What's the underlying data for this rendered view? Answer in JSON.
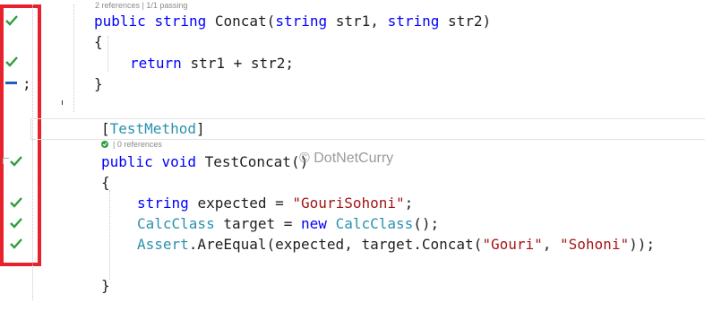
{
  "editor": {
    "codelens_top": "2 references | 1/1 passing",
    "codelens_test_refs": "| 0 references",
    "watermark": "© DotNetCurry",
    "method_concat": {
      "kw_public": "public",
      "kw_string1": "string",
      "name": "Concat(",
      "kw_string2": "string",
      "param1": "str1,",
      "kw_string3": "string",
      "param2": "str2)"
    },
    "brace_open_1": "{",
    "return_kw": "return",
    "return_expr": "str1 + str2;",
    "brace_close_1": "}",
    "semicolon": ";",
    "attribute_open": "[",
    "attribute_name": "TestMethod",
    "attribute_close": "]",
    "test_method": {
      "kw_public": "public",
      "kw_void": "void",
      "name": "TestConcat()"
    },
    "brace_open_2": "{",
    "line_expected": {
      "kw_string": "string",
      "text": "expected = ",
      "value": "\"GouriSohoni\"",
      "end": ";"
    },
    "line_target": {
      "type": "CalcClass",
      "text": " target = ",
      "kw_new": "new",
      "type2": "CalcClass",
      "end": "();"
    },
    "line_assert": {
      "type": "Assert",
      "text": ".AreEqual(expected, target.Concat(",
      "arg1": "\"Gouri\"",
      "sep": ", ",
      "arg2": "\"Sohoni\"",
      "end": "));"
    },
    "brace_close_2": "}"
  },
  "colors": {
    "keyword": "#0000ff",
    "type": "#2b91af",
    "string": "#a31515",
    "pass_check": "#2e9e3e",
    "highlight_box": "#e8222c",
    "not_run_dash": "#1f5fbf"
  },
  "gutter_icons": [
    "check-pass",
    "check-pass",
    "dash-not-covered",
    "check-pass",
    "check-pass",
    "check-pass",
    "check-pass"
  ]
}
